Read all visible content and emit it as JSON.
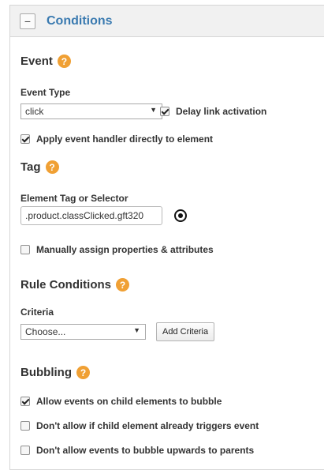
{
  "header": {
    "title": "Conditions",
    "collapse_symbol": "−"
  },
  "event": {
    "title": "Event",
    "help": "?",
    "type_label": "Event Type",
    "type_value": "click",
    "delay_label": "Delay link activation",
    "delay_checked": true,
    "apply_label": "Apply event handler directly to element",
    "apply_checked": true
  },
  "tag": {
    "title": "Tag",
    "help": "?",
    "selector_label": "Element Tag or Selector",
    "selector_value": ".product.classClicked.gft320",
    "manual_label": "Manually assign properties & attributes",
    "manual_checked": false
  },
  "rule_conditions": {
    "title": "Rule Conditions",
    "help": "?",
    "criteria_label": "Criteria",
    "criteria_value": "Choose...",
    "add_button": "Add Criteria"
  },
  "bubbling": {
    "title": "Bubbling",
    "help": "?",
    "options": [
      {
        "label": "Allow events on child elements to bubble",
        "checked": true
      },
      {
        "label": "Don't allow if child element already triggers event",
        "checked": false
      },
      {
        "label": "Don't allow events to bubble upwards to parents",
        "checked": false
      }
    ]
  },
  "icons": {
    "dropdown": "▼",
    "selector": "target-icon"
  }
}
